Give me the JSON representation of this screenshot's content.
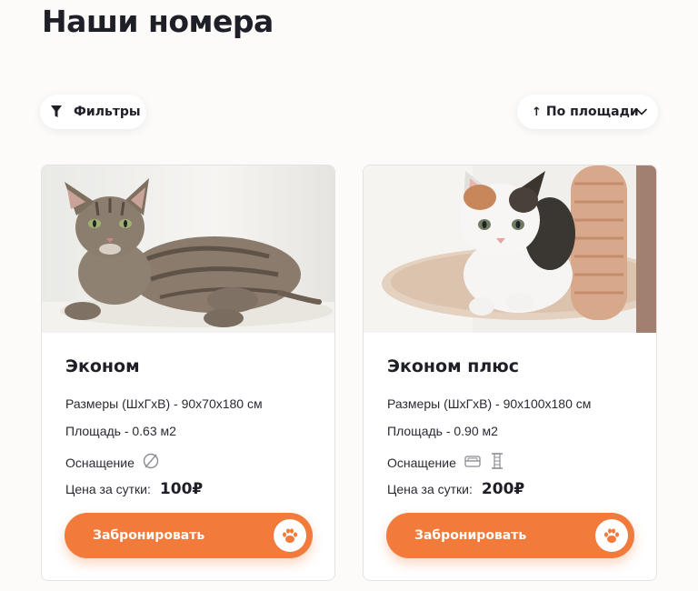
{
  "page": {
    "title": "Наши номера"
  },
  "toolbar": {
    "filters_label": "Фильтры",
    "sort_arrow": "↑",
    "sort_label": "По площади"
  },
  "rooms": [
    {
      "title": "Эконом",
      "size": "Размеры (ШхГхВ) - 90х70х180 см",
      "area": "Площадь - 0.63 м2",
      "equipment_label": "Оснащение",
      "equipment_icons": [
        "none-icon"
      ],
      "price_label": "Цена за сутки:",
      "price": "100₽",
      "book_label": "Забронировать"
    },
    {
      "title": "Эконом плюс",
      "size": "Размеры (ШхГхВ) - 90х100х180 см",
      "area": "Площадь - 0.90 м2",
      "equipment_label": "Оснащение",
      "equipment_icons": [
        "bed-icon",
        "scratching-post-icon"
      ],
      "price_label": "Цена за сутки:",
      "price": "200₽",
      "book_label": "Забронировать"
    }
  ],
  "colors": {
    "accent": "#f27a3a",
    "background": "#fcfbf9",
    "text": "#1f1f28"
  }
}
